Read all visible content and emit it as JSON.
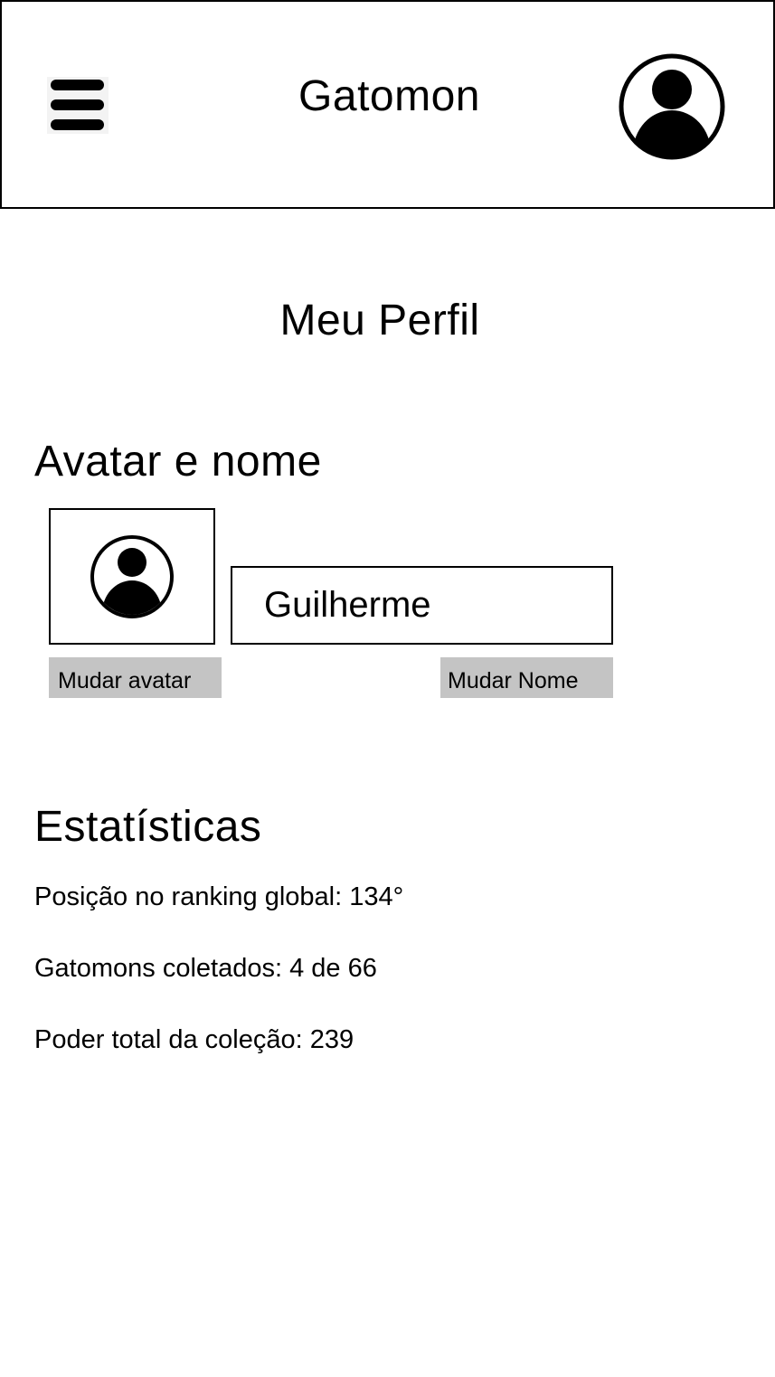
{
  "header": {
    "title": "Gatomon",
    "menu_icon": "hamburger-menu-icon",
    "profile_icon": "user-avatar-icon"
  },
  "page": {
    "title": "Meu Perfil"
  },
  "avatar_section": {
    "heading": "Avatar e nome",
    "avatar_icon": "user-avatar-icon",
    "name_value": "Guilherme",
    "change_avatar_label": "Mudar avatar",
    "change_name_label": "Mudar Nome"
  },
  "stats_section": {
    "heading": "Estatísticas",
    "ranking": "Posição no ranking global: 134°",
    "collected": "Gatomons coletados: 4 de 66",
    "power": "Poder total da coleção: 239"
  },
  "colors": {
    "foreground": "#000000",
    "background": "#ffffff",
    "button_gray": "#c4c4c4",
    "menu_bg": "#f3f3f3"
  }
}
